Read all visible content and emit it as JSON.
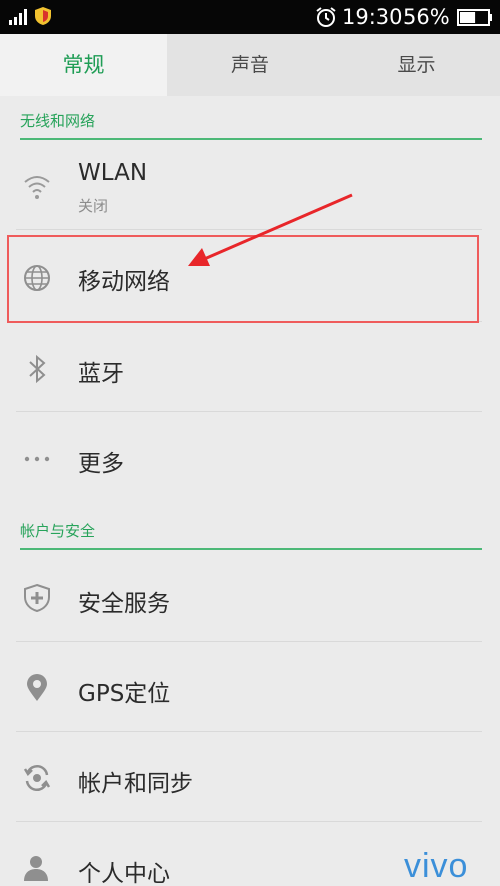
{
  "status_bar": {
    "time": "19:30",
    "battery_percent": "56%",
    "battery_level": 0.56
  },
  "tabs": [
    {
      "label": "常规",
      "active": true
    },
    {
      "label": "声音",
      "active": false
    },
    {
      "label": "显示",
      "active": false
    }
  ],
  "sections": {
    "wireless": {
      "header": "无线和网络"
    },
    "account": {
      "header": "帐户与安全"
    }
  },
  "wireless_items": {
    "wlan": {
      "title": "WLAN",
      "subtitle": "关闭",
      "icon": "wifi-icon"
    },
    "mobile": {
      "title": "移动网络",
      "icon": "globe-icon"
    },
    "bluetooth": {
      "title": "蓝牙",
      "icon": "bluetooth-icon"
    },
    "more": {
      "title": "更多",
      "icon": "more-icon"
    }
  },
  "account_items": {
    "security": {
      "title": "安全服务",
      "icon": "shield-icon"
    },
    "gps": {
      "title": "GPS定位",
      "icon": "location-pin-icon"
    },
    "sync": {
      "title": "帐户和同步",
      "icon": "sync-icon"
    },
    "personal": {
      "title": "个人中心",
      "icon": "person-icon"
    }
  },
  "brand": {
    "logo_text": "vivo"
  },
  "colors": {
    "accent_green": "#1f9d55",
    "highlight_red": "#ef5b5b",
    "brand_blue": "#3b8fd9"
  }
}
